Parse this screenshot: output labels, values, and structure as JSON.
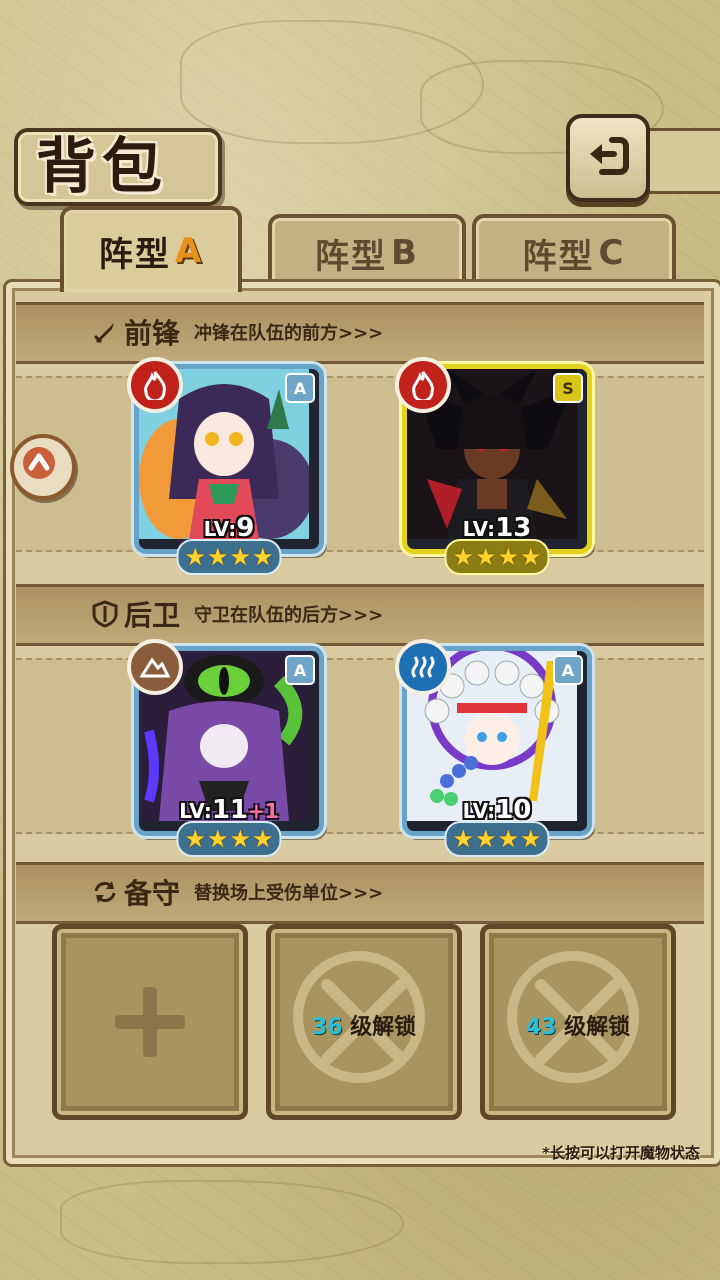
{
  "header": {
    "title": "背包"
  },
  "tabs": [
    {
      "label": "阵型",
      "suffix": "A",
      "active": true
    },
    {
      "label": "阵型",
      "suffix": "B",
      "active": false
    },
    {
      "label": "阵型",
      "suffix": "C",
      "active": false
    }
  ],
  "sections": {
    "front": {
      "title": "前锋",
      "desc": "冲锋在队伍的前方>>>"
    },
    "back": {
      "title": "后卫",
      "desc": "守卫在队伍的后方>>>"
    },
    "reserve": {
      "title": "备守",
      "desc": "替换场上受伤单位>>>"
    }
  },
  "units": [
    {
      "element": "fire",
      "rank": "A",
      "lv_prefix": "LV:",
      "lv": "9",
      "bonus": "",
      "stars": 4
    },
    {
      "element": "fire",
      "rank": "S",
      "lv_prefix": "LV:",
      "lv": "13",
      "bonus": "",
      "stars": 4
    },
    {
      "element": "earth",
      "rank": "A",
      "lv_prefix": "LV:",
      "lv": "11",
      "bonus": "+1",
      "stars": 4
    },
    {
      "element": "water",
      "rank": "A",
      "lv_prefix": "LV:",
      "lv": "10",
      "bonus": "",
      "stars": 4
    }
  ],
  "reserve_slots": [
    {
      "state": "empty"
    },
    {
      "state": "locked",
      "level": "36",
      "text": "级解锁"
    },
    {
      "state": "locked",
      "level": "43",
      "text": "级解锁"
    }
  ],
  "hint": "*长按可以打开魔物状态",
  "colors": {
    "rank_a": "#6fa6c8",
    "rank_s": "#e2d21c",
    "fire": "#c0211b",
    "earth": "#8a5c3c",
    "water": "#1f6fb3"
  }
}
